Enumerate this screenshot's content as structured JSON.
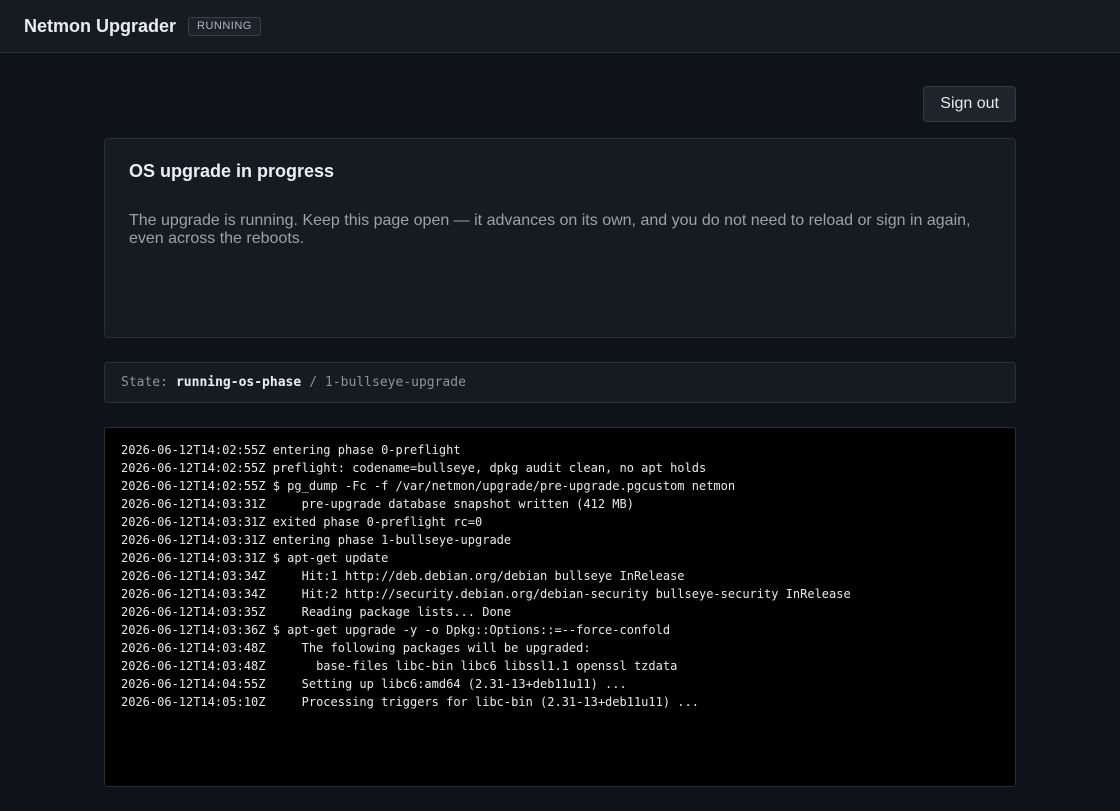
{
  "header": {
    "title": "Netmon Upgrader",
    "badge": "RUNNING"
  },
  "actions": {
    "sign_out_label": "Sign out"
  },
  "card": {
    "title": "OS upgrade in progress",
    "body": "The upgrade is running. Keep this page open — it advances on its own, and you do not need to reload or sign in again, even across the reboots."
  },
  "state": {
    "label": "State:",
    "value": "running-os-phase",
    "separator": "/",
    "phase": "1-bullseye-upgrade"
  },
  "log": {
    "lines": [
      "2026-06-12T14:02:55Z entering phase 0-preflight",
      "2026-06-12T14:02:55Z preflight: codename=bullseye, dpkg audit clean, no apt holds",
      "2026-06-12T14:02:55Z $ pg_dump -Fc -f /var/netmon/upgrade/pre-upgrade.pgcustom netmon",
      "2026-06-12T14:03:31Z     pre-upgrade database snapshot written (412 MB)",
      "2026-06-12T14:03:31Z exited phase 0-preflight rc=0",
      "2026-06-12T14:03:31Z entering phase 1-bullseye-upgrade",
      "2026-06-12T14:03:31Z $ apt-get update",
      "2026-06-12T14:03:34Z     Hit:1 http://deb.debian.org/debian bullseye InRelease",
      "2026-06-12T14:03:34Z     Hit:2 http://security.debian.org/debian-security bullseye-security InRelease",
      "2026-06-12T14:03:35Z     Reading package lists... Done",
      "2026-06-12T14:03:36Z $ apt-get upgrade -y -o Dpkg::Options::=--force-confold",
      "2026-06-12T14:03:48Z     The following packages will be upgraded:",
      "2026-06-12T14:03:48Z       base-files libc-bin libc6 libssl1.1 openssl tzdata",
      "2026-06-12T14:04:55Z     Setting up libc6:amd64 (2.31-13+deb11u11) ...",
      "2026-06-12T14:05:10Z     Processing triggers for libc-bin (2.31-13+deb11u11) ..."
    ]
  }
}
